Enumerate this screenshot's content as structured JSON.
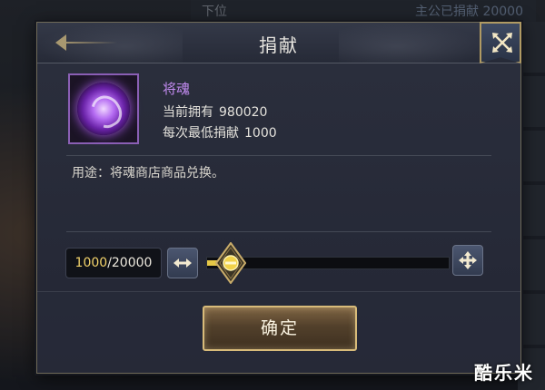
{
  "background": {
    "header_rank": "下位",
    "header_top": "主公已捐献 20000"
  },
  "dialog": {
    "title": "捐献",
    "close_icon": "crossed-arrows-close-icon"
  },
  "item": {
    "name": "将魂",
    "icon": "purple-soul-orb-icon",
    "owned_label": "当前拥有",
    "owned_value": "980020",
    "min_label": "每次最低捐献",
    "min_value": "1000",
    "usage": "用途：将魂商店商品兑换。"
  },
  "slider": {
    "current": "1000",
    "max_text": "/20000",
    "progress": 0.05
  },
  "buttons": {
    "confirm": "确定"
  },
  "watermark": "酷乐米",
  "colors": {
    "accent_gold": "#d8bb7a",
    "item_name_purple": "#c48cf3",
    "slider_fill": "#e6c847"
  }
}
